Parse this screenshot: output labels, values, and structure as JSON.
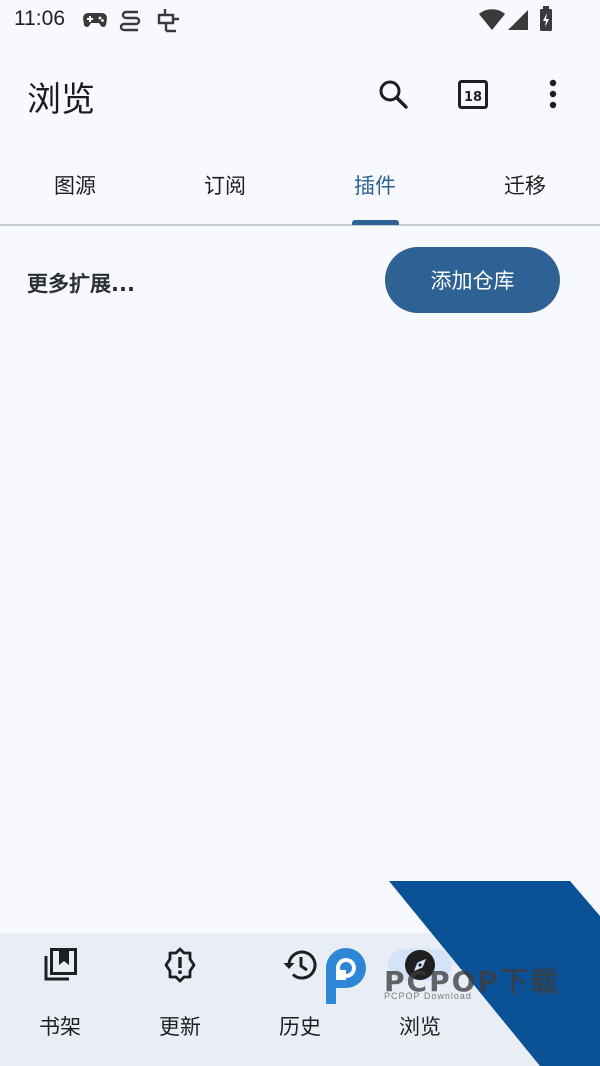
{
  "status_bar": {
    "time": "11:06",
    "icons": [
      "gamepad-icon",
      "notification-app-icon",
      "bug-icon",
      "wifi-icon",
      "cell-signal-icon",
      "battery-charging-icon"
    ]
  },
  "app_bar": {
    "title": "浏览",
    "actions": [
      "search-icon",
      "calendar-18-icon",
      "more-vert-icon"
    ],
    "calendar_badge": "18"
  },
  "tabs": {
    "items": [
      {
        "label": "图源"
      },
      {
        "label": "订阅"
      },
      {
        "label": "插件"
      },
      {
        "label": "迁移"
      }
    ],
    "active_index": 2
  },
  "content": {
    "more_label": "更多扩展...",
    "add_repo_label": "添加仓库"
  },
  "bottom_nav": {
    "items": [
      {
        "label": "书架",
        "icon": "library-icon"
      },
      {
        "label": "更新",
        "icon": "alert-badge-icon"
      },
      {
        "label": "历史",
        "icon": "history-icon"
      },
      {
        "label": "浏览",
        "icon": "explore-icon"
      }
    ],
    "active_index": 3
  },
  "watermark": {
    "brand": "PCPOP下载",
    "sub": "PCPOP Download"
  },
  "colors": {
    "primary": "#2e6294",
    "background": "#f7f9fe",
    "nav_background": "#e9eef6",
    "active_pill": "#d4e3f7",
    "watermark_blue": "#0a5196"
  }
}
